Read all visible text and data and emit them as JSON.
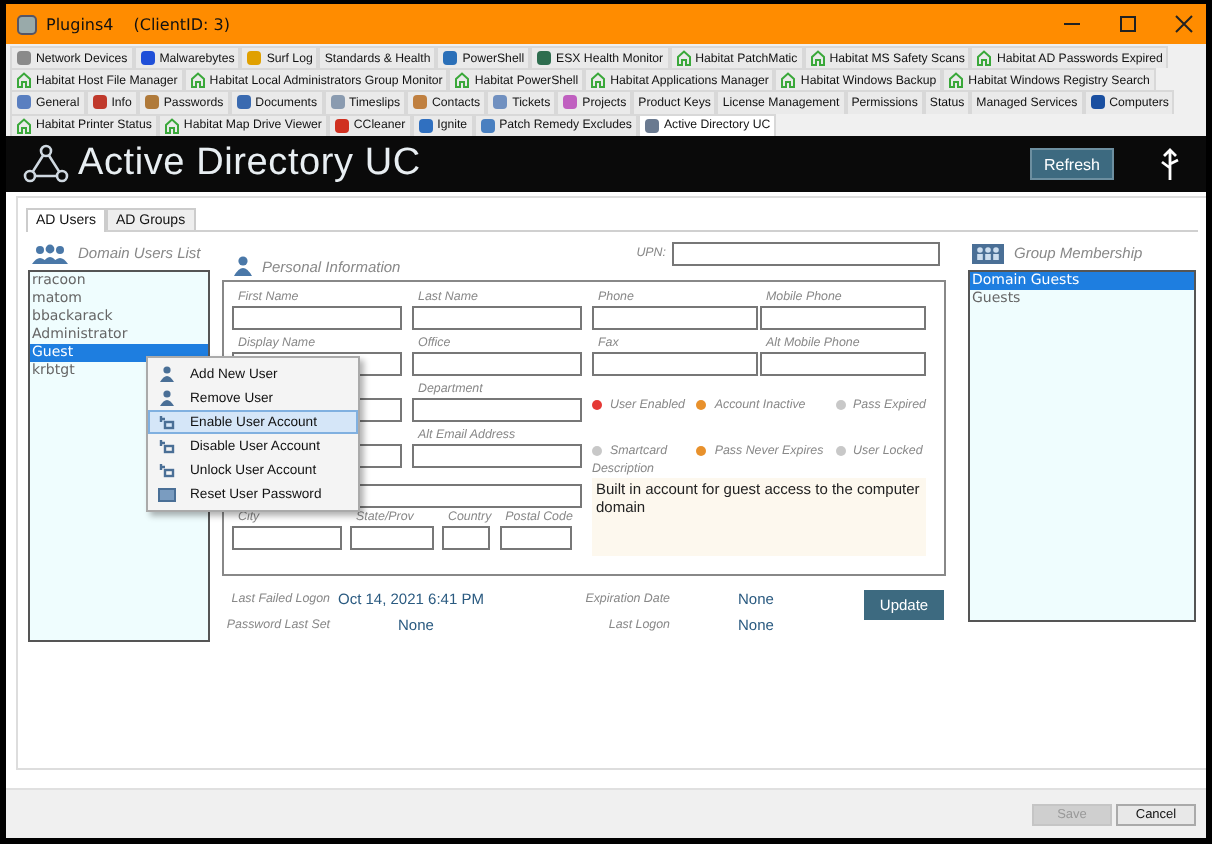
{
  "window": {
    "title": "Plugins4",
    "client_id": "(ClientID: 3)"
  },
  "plugin_tab_rows": [
    {
      "tabs": [
        {
          "label": "Network Devices",
          "kind": "app",
          "color": "#8a8a8a",
          "selected": false
        },
        {
          "label": "Malwarebytes",
          "kind": "app",
          "color": "#1f4fd8",
          "selected": false
        },
        {
          "label": "Surf Log",
          "kind": "app",
          "color": "#e0a000",
          "selected": false
        },
        {
          "label": "Standards & Health",
          "kind": "plain",
          "selected": false
        },
        {
          "label": "PowerShell",
          "kind": "app",
          "color": "#2a6fb8",
          "selected": false
        },
        {
          "label": "ESX Health Monitor",
          "kind": "app",
          "color": "#2e6d4f",
          "selected": false
        },
        {
          "label": "Habitat PatchMatic",
          "kind": "habitat",
          "selected": false
        },
        {
          "label": "Habitat MS Safety Scans",
          "kind": "habitat",
          "selected": false
        },
        {
          "label": "Habitat AD Passwords Expired",
          "kind": "habitat",
          "selected": false
        }
      ]
    },
    {
      "tabs": [
        {
          "label": "Habitat Host File Manager",
          "kind": "habitat",
          "selected": false
        },
        {
          "label": "Habitat Local Administrators Group Monitor",
          "kind": "habitat",
          "selected": false
        },
        {
          "label": "Habitat PowerShell",
          "kind": "habitat",
          "selected": false
        },
        {
          "label": "Habitat Applications Manager",
          "kind": "habitat",
          "selected": false
        },
        {
          "label": "Habitat Windows Backup",
          "kind": "habitat",
          "selected": false
        },
        {
          "label": "Habitat Windows Registry Search",
          "kind": "habitat",
          "selected": false
        }
      ]
    },
    {
      "tabs": [
        {
          "label": "General",
          "kind": "app",
          "color": "#5a7fc0",
          "selected": false
        },
        {
          "label": "Info",
          "kind": "app",
          "color": "#c0392b",
          "selected": false
        },
        {
          "label": "Passwords",
          "kind": "app",
          "color": "#b07a3a",
          "selected": false
        },
        {
          "label": "Documents",
          "kind": "app",
          "color": "#3a6ab0",
          "selected": false
        },
        {
          "label": "Timeslips",
          "kind": "app",
          "color": "#8a9bb0",
          "selected": false
        },
        {
          "label": "Contacts",
          "kind": "app",
          "color": "#c08040",
          "selected": false
        },
        {
          "label": "Tickets",
          "kind": "app",
          "color": "#7090c0",
          "selected": false
        },
        {
          "label": "Projects",
          "kind": "app",
          "color": "#c060c0",
          "selected": false
        },
        {
          "label": "Product Keys",
          "kind": "plain",
          "selected": false
        },
        {
          "label": "License Management",
          "kind": "plain",
          "selected": false
        },
        {
          "label": "Permissions",
          "kind": "plain",
          "selected": false
        },
        {
          "label": "Status",
          "kind": "plain",
          "selected": false
        },
        {
          "label": "Managed Services",
          "kind": "plain",
          "selected": false
        },
        {
          "label": "Computers",
          "kind": "app",
          "color": "#1a4fa0",
          "selected": false
        }
      ]
    },
    {
      "tabs": [
        {
          "label": "Habitat Printer Status",
          "kind": "habitat",
          "selected": false
        },
        {
          "label": "Habitat Map Drive Viewer",
          "kind": "habitat",
          "selected": false
        },
        {
          "label": "CCleaner",
          "kind": "app",
          "color": "#d03020",
          "selected": false
        },
        {
          "label": "Ignite",
          "kind": "app",
          "color": "#3070c0",
          "selected": false
        },
        {
          "label": "Patch Remedy Excludes",
          "kind": "app",
          "color": "#4a80c0",
          "selected": false
        },
        {
          "label": "Active Directory UC",
          "kind": "app",
          "color": "#6a7a90",
          "selected": true
        }
      ]
    }
  ],
  "header": {
    "title": "Active Directory UC",
    "refresh_button": "Refresh"
  },
  "sub_tabs": [
    {
      "label": "AD Users",
      "selected": true
    },
    {
      "label": "AD Groups",
      "selected": false
    }
  ],
  "users_list": {
    "title": "Domain Users List",
    "items": [
      {
        "name": "rracoon",
        "selected": false
      },
      {
        "name": "matom",
        "selected": false
      },
      {
        "name": "bbackarack",
        "selected": false
      },
      {
        "name": "Administrator",
        "selected": false
      },
      {
        "name": "Guest",
        "selected": true
      },
      {
        "name": "krbtgt",
        "selected": false
      }
    ]
  },
  "personal_info": {
    "title": "Personal Information",
    "upn_label": "UPN:",
    "field_labels": {
      "first_name": "First Name",
      "last_name": "Last Name",
      "phone": "Phone",
      "mobile_phone": "Mobile Phone",
      "display_name": "Display Name",
      "office": "Office",
      "fax": "Fax",
      "alt_mobile_phone": "Alt Mobile Phone",
      "department": "Department",
      "alt_email_address": "Alt Email Address",
      "city": "City",
      "state_prov": "State/Prov",
      "country": "Country",
      "postal_code": "Postal Code"
    },
    "flags": [
      {
        "label": "User Enabled",
        "color": "#e53935"
      },
      {
        "label": "Account Inactive",
        "color": "#e8912c"
      },
      {
        "label": "Pass Expired",
        "color": "#c8c8c8"
      },
      {
        "label": "Smartcard",
        "color": "#c8c8c8"
      },
      {
        "label": "Pass Never Expires",
        "color": "#e8912c"
      },
      {
        "label": "User Locked",
        "color": "#c8c8c8"
      }
    ],
    "description": {
      "label": "Description",
      "value": "Built in account for guest access to the computer domain"
    }
  },
  "logon_info": [
    {
      "label": "Last Failed Logon",
      "value": "Oct 14, 2021 6:41 PM"
    },
    {
      "label": "Expiration Date",
      "value": "None"
    },
    {
      "label": "Password Last Set",
      "value": "None"
    },
    {
      "label": "Last Logon",
      "value": "None"
    }
  ],
  "update_button": "Update",
  "group_membership": {
    "title": "Group Membership",
    "items": [
      {
        "name": "Domain Guests",
        "selected": true
      },
      {
        "name": "Guests",
        "selected": false
      }
    ]
  },
  "context_menu": [
    {
      "label": "Add New User",
      "kind": "user",
      "selected": false
    },
    {
      "label": "Remove User",
      "kind": "user",
      "selected": false
    },
    {
      "label": "Enable User Account",
      "kind": "account",
      "selected": true
    },
    {
      "label": "Disable User Account",
      "kind": "account",
      "selected": false
    },
    {
      "label": "Unlock User Account",
      "kind": "account",
      "selected": false
    },
    {
      "label": "Reset User Password",
      "kind": "password",
      "selected": false
    }
  ],
  "footer": {
    "save_button": {
      "label": "Save",
      "disabled": true
    },
    "cancel_button": {
      "label": "Cancel",
      "disabled": false
    }
  }
}
